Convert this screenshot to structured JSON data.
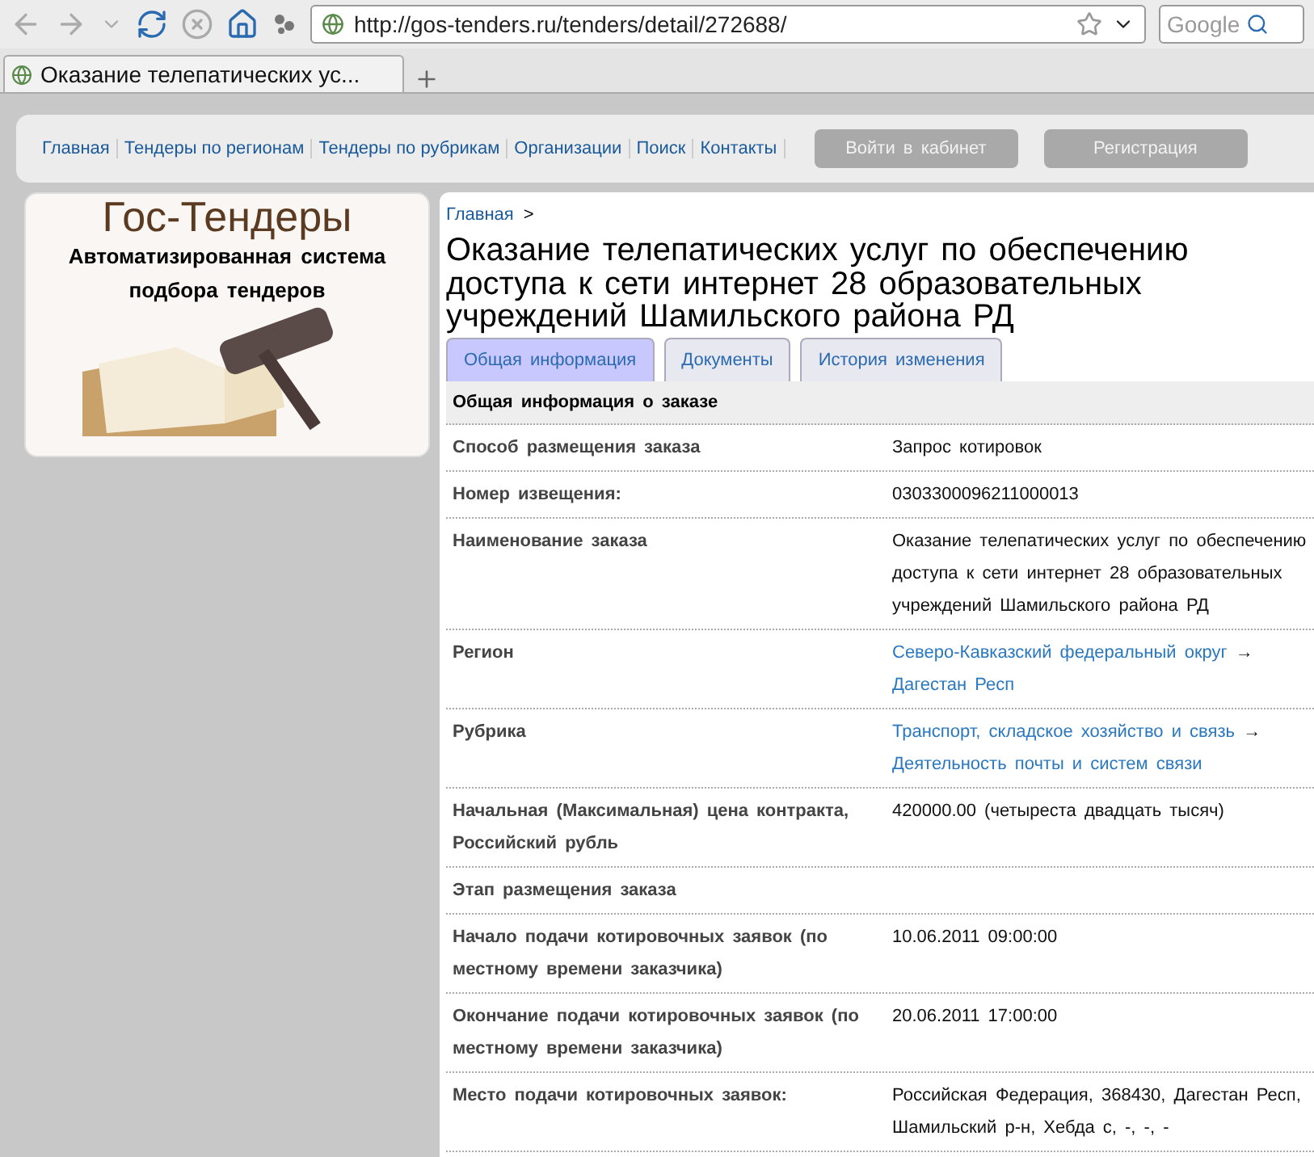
{
  "browser": {
    "url": "http://gos-tenders.ru/tenders/detail/272688/",
    "search_placeholder": "Google",
    "tab_title": "Оказание телепатических ус..."
  },
  "nav": {
    "links": [
      "Главная",
      "Тендеры по регионам",
      "Тендеры по рубрикам",
      "Организации",
      "Поиск",
      "Контакты"
    ],
    "buttons": [
      "Войти в кабинет",
      "Регистрация"
    ]
  },
  "logo": {
    "title": "Гос-Тендеры",
    "subtitle": "Автоматизированная система подбора тендеров"
  },
  "breadcrumb": {
    "link": "Главная",
    "separator": ">"
  },
  "page_title": "Оказание телепатических услуг по обеспечению доступа к сети интернет 28 образовательных учреждений Шамильского района РД",
  "tabs": [
    {
      "label": "Общая информация",
      "selected": true
    },
    {
      "label": "Документы",
      "selected": false
    },
    {
      "label": "История изменения",
      "selected": false
    }
  ],
  "section_title": "Общая информация о заказе",
  "rows": [
    {
      "label": "Способ размещения заказа",
      "kind": "text",
      "value": "Запрос котировок"
    },
    {
      "label": "Номер извещения:",
      "kind": "text",
      "value": "0303300096211000013"
    },
    {
      "label": "Наименование заказа",
      "kind": "text",
      "value": "Оказание телепатических услуг по обеспечению доступа к сети интернет 28 образовательных учреждений Шамильского района РД"
    },
    {
      "label": "Регион",
      "kind": "links",
      "links": [
        "Северо-Кавказский федеральный округ",
        "Дагестан Респ"
      ],
      "separator": "→"
    },
    {
      "label": "Рубрика",
      "kind": "links",
      "links": [
        "Транспорт, складское хозяйство и связь",
        "Деятельность почты и систем связи"
      ],
      "separator": "→"
    },
    {
      "label": "Начальная (Максимальная) цена контракта, Российский рубль",
      "kind": "text",
      "value": "420000.00 (четыреста двадцать тысяч)"
    },
    {
      "label": "Этап размещения заказа",
      "kind": "empty"
    },
    {
      "label": "Начало подачи котировочных заявок (по местному времени заказчика)",
      "kind": "text",
      "value": "10.06.2011 09:00:00"
    },
    {
      "label": "Окончание подачи котировочных заявок (по местному времени заказчика)",
      "kind": "text",
      "value": "20.06.2011 17:00:00"
    },
    {
      "label": "Место подачи котировочных заявок:",
      "kind": "text",
      "value": "Российская Федерация, 368430, Дагестан Респ, Шамильский р-н, Хебда с, -, -, -"
    }
  ]
}
